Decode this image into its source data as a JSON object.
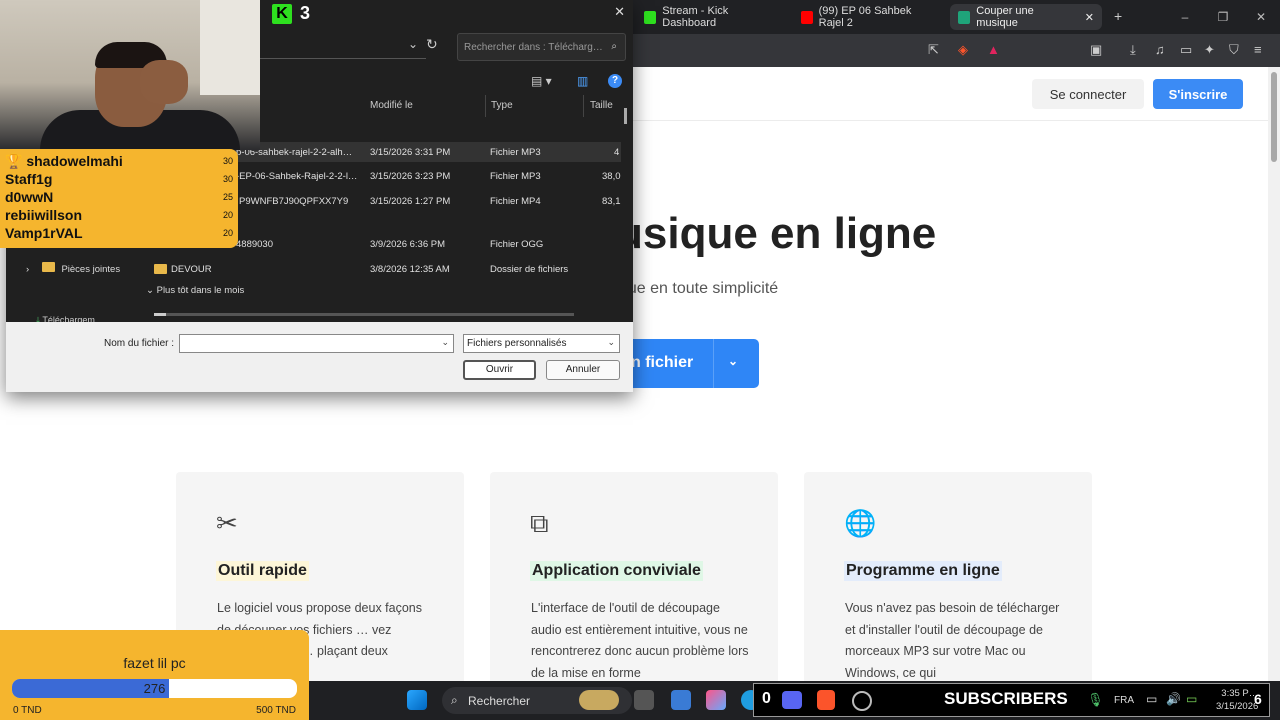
{
  "browser": {
    "tabs": [
      {
        "label": "Stream - Kick Dashboard",
        "icon": "kick-icon"
      },
      {
        "label": "(99) EP 06 Sahbek Rajel 2",
        "icon": "youtube-icon"
      },
      {
        "label": "Couper une musique",
        "icon": "play-icon"
      }
    ],
    "new_tab": "+",
    "window_controls": [
      "–",
      "❐",
      "✕"
    ],
    "tab_close": "✕"
  },
  "site": {
    "login": "Se connecter",
    "signup": "S'inscrire",
    "hero_title": "usique en ligne",
    "hero_sub": "que en toute simplicité",
    "upload_label": "n fichier",
    "upload_chevron": "⌄",
    "cards": [
      {
        "icon": "scissors-icon",
        "glyph": "✂",
        "title": "Outil rapide",
        "highlight": "#fdf6d8",
        "desc": "Le logiciel vous propose deux façons de découper vos fichiers … vez sélectionner la … plaçant deux"
      },
      {
        "icon": "devices-icon",
        "glyph": "⧉",
        "title": "Application conviviale",
        "highlight": "#dff7e6",
        "desc": "L'interface de l'outil de découpage audio est entièrement intuitive, vous ne rencontrerez donc aucun problème lors de la mise en forme"
      },
      {
        "icon": "globe-icon",
        "glyph": "🌐",
        "title": "Programme en ligne",
        "highlight": "#e3ecfb",
        "desc": "Vous n'avez pas besoin de télécharger et d'installer l'outil de découpage de morceaux MP3 sur votre Mac ou Windows, ce qui"
      }
    ]
  },
  "dialog": {
    "kick_number": "3",
    "close": "✕",
    "search_placeholder": "Rechercher dans : Télécharg…",
    "columns": {
      "modified": "Modifié le",
      "type": "Type",
      "size": "Taille"
    },
    "files": [
      {
        "name": "p-06-sahbek-rajel-2-2-alh…",
        "date": "3/15/2026 3:31 PM",
        "type": "Fichier MP3",
        "size": "4",
        "selected": true
      },
      {
        "name": "-EP-06-Sahbek-Rajel-2-2-l…",
        "date": "3/15/2026 3:23 PM",
        "type": "Fichier MP3",
        "size": "38,0"
      },
      {
        "name": "P9WNFB7J90QPFXX7Y9",
        "date": "3/15/2026 1:27 PM",
        "type": "Fichier MP4",
        "size": "83,1"
      },
      {
        "name": "4889030",
        "date": "3/9/2026 6:36 PM",
        "type": "Fichier OGG",
        "size": ""
      },
      {
        "name": "DEVOUR",
        "date": "3/8/2026 12:35 AM",
        "type": "Dossier de fichiers",
        "size": "",
        "folder": true
      }
    ],
    "nav_item": "Pièces jointes",
    "nav_item2": "Téléchargem…",
    "group_header": "Plus tôt dans le mois",
    "filename_label": "Nom du fichier :",
    "filename_value": "",
    "filetype": "Fichiers personnalisés",
    "open": "Ouvrir",
    "cancel": "Annuler"
  },
  "leaderboard": [
    {
      "name": "shadowelmahi",
      "value": "30",
      "trophy": true
    },
    {
      "name": "Staff1g",
      "value": "30"
    },
    {
      "name": "d0wwN",
      "value": "25"
    },
    {
      "name": "rebiiwillson",
      "value": "20"
    },
    {
      "name": "Vamp1rVAL",
      "value": "20"
    }
  ],
  "goal": {
    "title": "fazet lil pc",
    "current": "276",
    "progress": 0.552,
    "min": "0 TND",
    "max": "500 TND"
  },
  "taskbar": {
    "search": "Rechercher",
    "subs_count": "0",
    "subs_label": "SUBSCRIBERS",
    "lang": "FRA",
    "time": "3:35 P…",
    "date": "3/15/2026",
    "notif": "6"
  }
}
